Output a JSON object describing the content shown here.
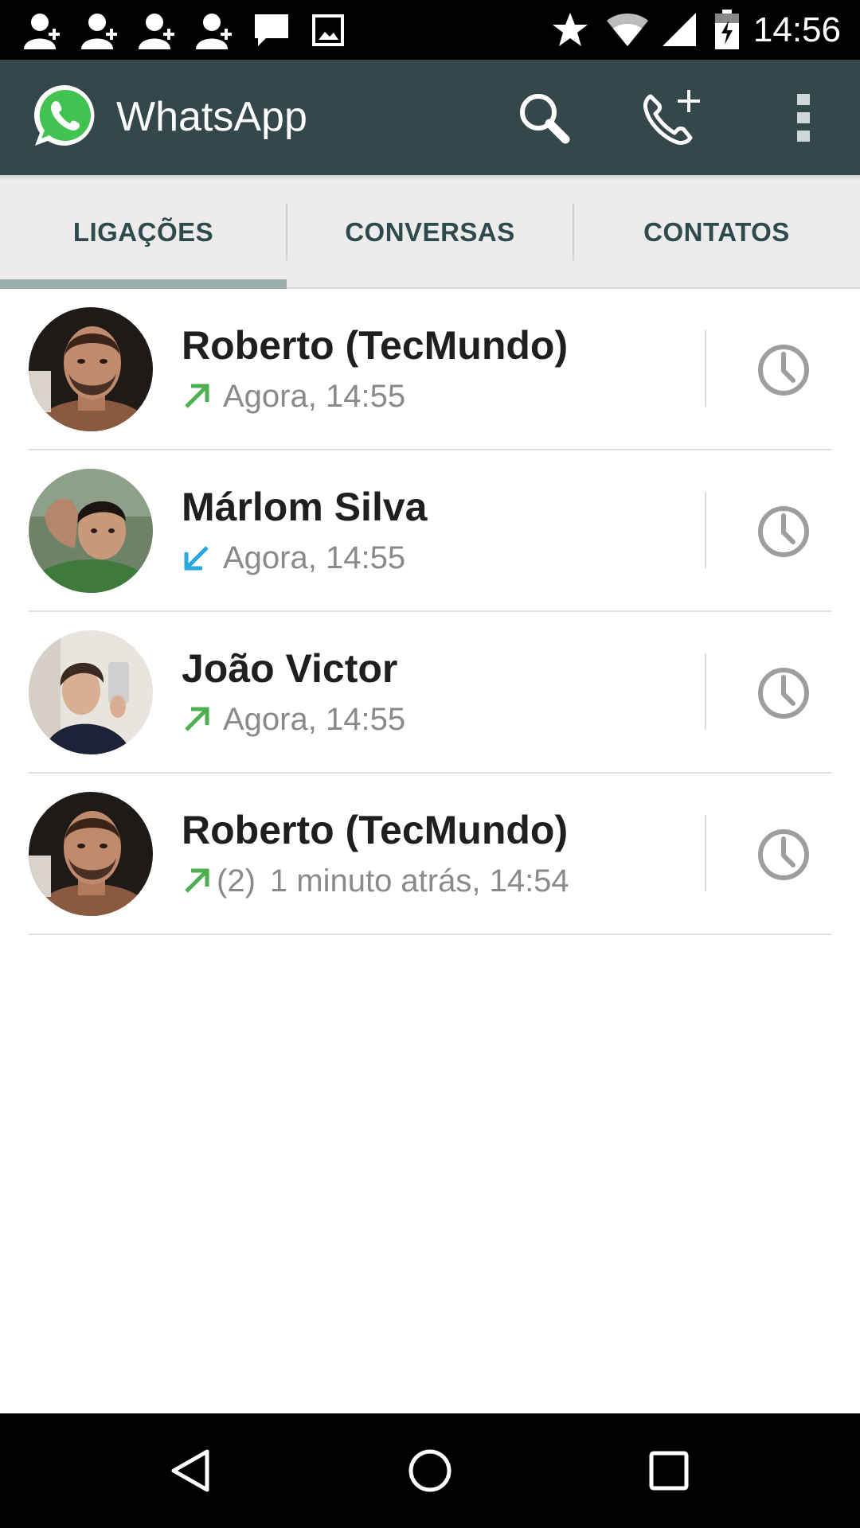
{
  "status_bar": {
    "time": "14:56",
    "left_icons": [
      "person-add-icon",
      "person-add-icon",
      "person-add-icon",
      "person-add-icon",
      "message-icon",
      "image-icon"
    ],
    "right_icons": [
      "star-icon",
      "wifi-icon",
      "signal-icon",
      "battery-charging-icon"
    ]
  },
  "action_bar": {
    "title": "WhatsApp",
    "actions": [
      "search-icon",
      "add-call-icon",
      "overflow-menu-icon"
    ],
    "color": "#34474a"
  },
  "tabs": [
    {
      "label": "LIGAÇÕES",
      "selected": true
    },
    {
      "label": "CONVERSAS",
      "selected": false
    },
    {
      "label": "CONTATOS",
      "selected": false
    }
  ],
  "calls": [
    {
      "name": "Roberto (TecMundo)",
      "direction": "outgoing",
      "count": "",
      "time": "Agora, 14:55"
    },
    {
      "name": "Márlom Silva",
      "direction": "incoming",
      "count": "",
      "time": "Agora, 14:55"
    },
    {
      "name": "João Victor",
      "direction": "outgoing",
      "count": "",
      "time": "Agora, 14:55"
    },
    {
      "name": "Roberto (TecMundo)",
      "direction": "outgoing",
      "count": "(2)",
      "time": "1 minuto atrás, 14:54"
    }
  ],
  "colors": {
    "outgoing_arrow": "#4caf50",
    "incoming_arrow": "#2aa9e0",
    "brand": "#34474a"
  },
  "nav_bar": [
    "back-icon",
    "home-icon",
    "recents-icon"
  ]
}
